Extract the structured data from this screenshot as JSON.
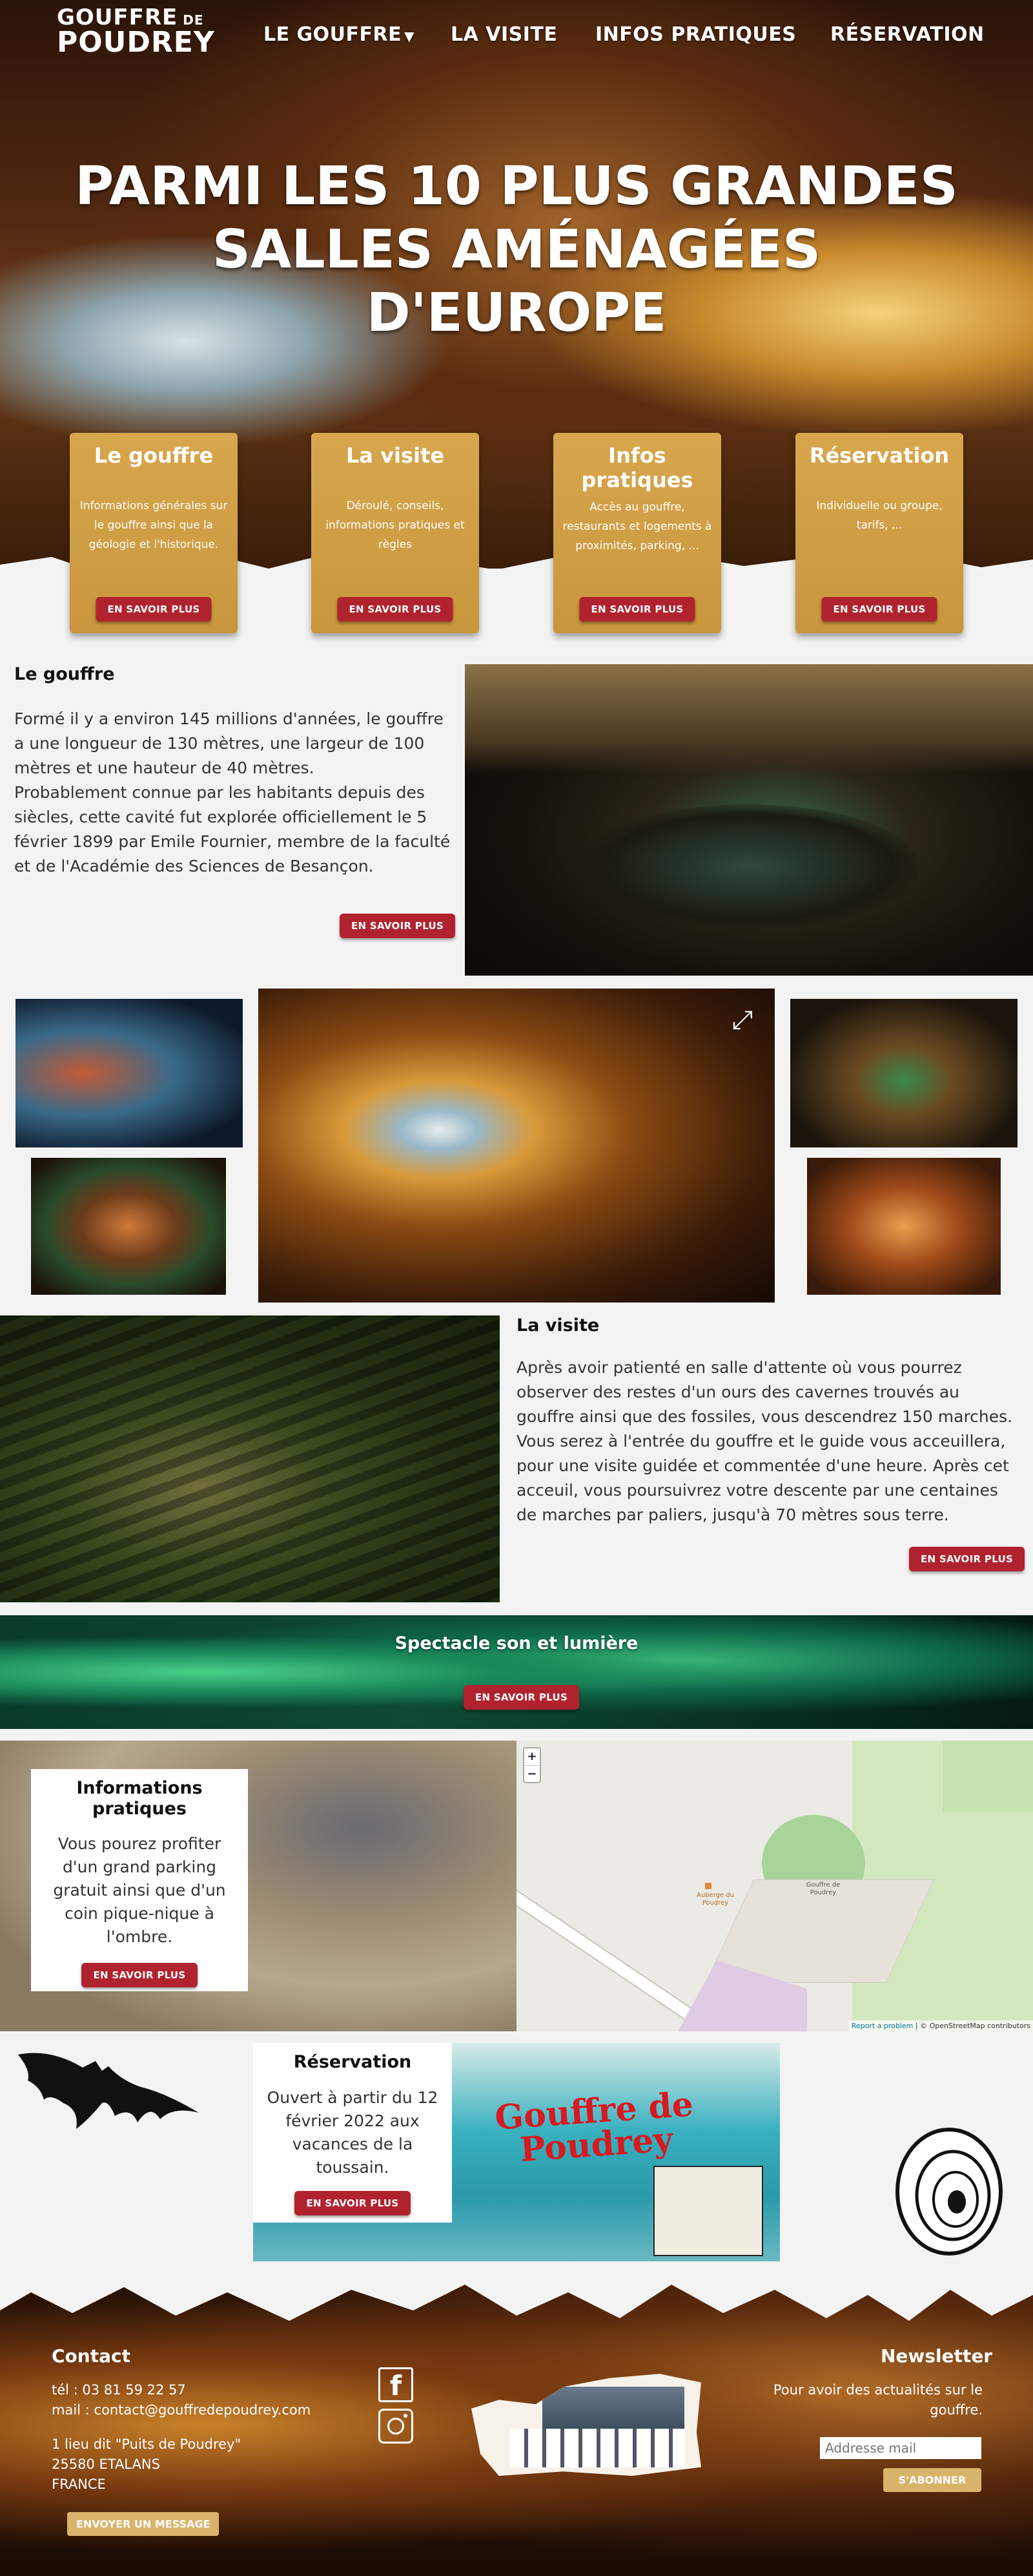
{
  "header": {
    "logo_line1": "GOUFFRE",
    "logo_de": "DE",
    "logo_line2": "POUDREY",
    "nav": [
      {
        "label": "LE GOUFFRE",
        "has_dropdown": true
      },
      {
        "label": "LA VISITE"
      },
      {
        "label": "INFOS PRATIQUES"
      },
      {
        "label": "RÉSERVATION"
      }
    ],
    "dropdown_icon": "caret-down-icon"
  },
  "hero": {
    "title_lines": [
      "PARMI LES 10 PLUS GRANDES",
      "SALLES AMÉNAGÉES",
      "D'EUROPE"
    ]
  },
  "cards": [
    {
      "title": "Le gouffre",
      "text": "Informations générales sur le gouffre ainsi que la géologie et l'historique.",
      "button": "EN SAVOIR PLUS"
    },
    {
      "title": "La visite",
      "text": "Déroulé, conseils, informations pratiques et règles",
      "button": "EN SAVOIR PLUS"
    },
    {
      "title": "Infos pratiques",
      "text": "Accès au gouffre, restaurants et logements à proximités, parking, ...",
      "button": "EN SAVOIR PLUS"
    },
    {
      "title": "Réservation",
      "text": "Individuelle ou groupe, tarifs, ...",
      "button": "EN SAVOIR PLUS"
    }
  ],
  "gouffre": {
    "title": "Le gouffre",
    "text": "Formé il y a environ 145 millions d'années, le gouffre a une longueur de 130 mètres, une largeur de 100 mètres et une hauteur de 40 mètres.\nProbablement connue par les habitants depuis des siècles, cette cavité fut explorée officiellement le 5 février 1899 par Emile Fournier, membre de la faculté et de l'Académie des Sciences de Besançon.",
    "button": "EN SAVOIR PLUS"
  },
  "gallery": {
    "expand_icon": "expand-icon"
  },
  "visite": {
    "title": "La visite",
    "text": "Après avoir patienté en salle d'attente où vous pourrez observer des restes d'un ours des cavernes trouvés au gouffre ainsi que des fossiles, vous descendrez 150 marches.\nVous serez à l'entrée du gouffre et le guide vous acceuillera, pour une visite guidée et commentée d'une heure. Après cet acceuil, vous poursuivrez votre descente par une centaines de marches par paliers, jusqu'à 70 mètres sous terre.",
    "button": "EN SAVOIR PLUS"
  },
  "spectacle": {
    "title": "Spectacle son et lumière",
    "button": "EN SAVOIR PLUS"
  },
  "infos": {
    "title": "Informations pratiques",
    "text": "Vous pourez profiter d'un grand parking gratuit ainsi que d'un coin pique-nique à l'ombre.",
    "button": "EN SAVOIR PLUS"
  },
  "map": {
    "zoom_in": "+",
    "zoom_out": "−",
    "label_auberge": "Auberge du Poudrey",
    "label_gouffre": "Gouffre de Poudrey",
    "attribution_report": "Report a problem",
    "attribution_osm": "| © OpenStreetMap contributors"
  },
  "reservation": {
    "title": "Réservation",
    "text": "Ouvert à partir du 12 février 2022 aux vacances de la toussain.",
    "button": "EN SAVOIR PLUS",
    "sign_line1": "Gouffre de",
    "sign_line2": "Poudrey"
  },
  "footer": {
    "contact_title": "Contact",
    "tel": "tél : 03 81 59 22 57",
    "mail": "mail : contact@gouffredepoudrey.com",
    "address": [
      "1 lieu dit \"Puits de Poudrey\"",
      "25580 ETALANS",
      "FRANCE"
    ],
    "message_button": "ENVOYER UN MESSAGE",
    "social": [
      {
        "icon": "facebook-icon"
      },
      {
        "icon": "instagram-icon"
      }
    ],
    "newsletter_title": "Newsletter",
    "newsletter_text": "Pour avoir des actualités sur le gouffre.",
    "newsletter_placeholder": "Addresse mail",
    "subscribe_button": "S'ABONNER"
  },
  "colors": {
    "accent_red": "#b0232e",
    "card_gold": "#d2a046",
    "bg": "#f4f3f3"
  }
}
